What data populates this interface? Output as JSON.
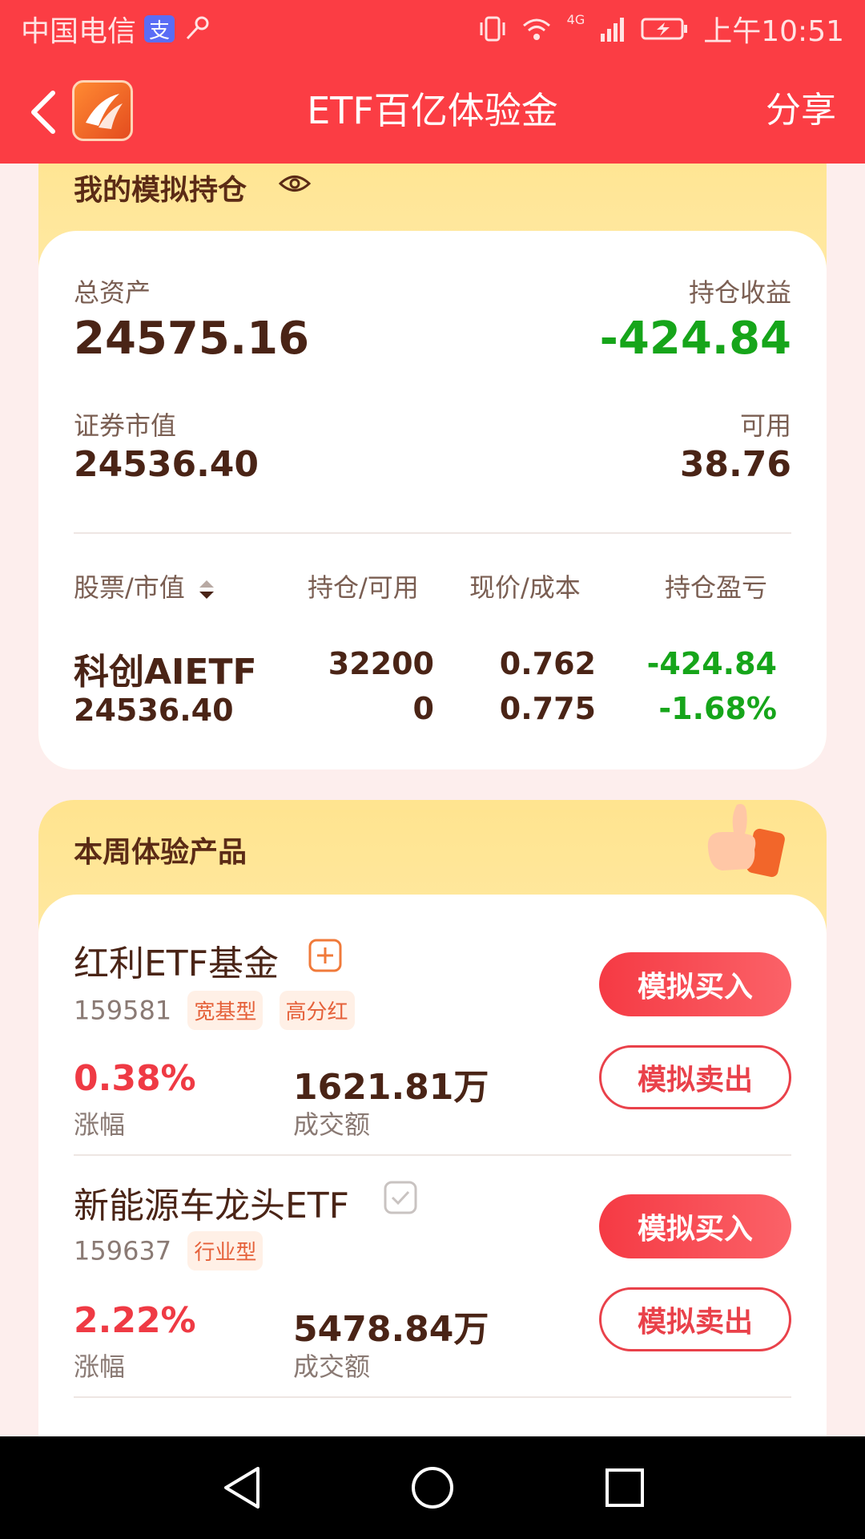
{
  "status_bar": {
    "carrier": "中国电信",
    "alipay_glyph": "支",
    "network": "4G",
    "time": "上午10:51"
  },
  "nav": {
    "title": "ETF百亿体验金",
    "share": "分享"
  },
  "holdings": {
    "title": "我的模拟持仓",
    "total_assets_label": "总资产",
    "total_assets": "24575.16",
    "profit_label": "持仓收益",
    "profit": "-424.84",
    "market_value_label": "证券市值",
    "market_value": "24536.40",
    "available_label": "可用",
    "available": "38.76",
    "columns": [
      "股票/市值",
      "持仓/可用",
      "现价/成本",
      "持仓盈亏"
    ],
    "rows": [
      {
        "name": "科创AIETF",
        "value": "24536.40",
        "position": "32200",
        "available": "0",
        "price": "0.762",
        "cost": "0.775",
        "pnl": "-424.84",
        "pnl_pct": "-1.68%"
      }
    ]
  },
  "products": {
    "title": "本周体验产品",
    "items": [
      {
        "name": "红利ETF基金",
        "code": "159581",
        "tags": [
          "宽基型",
          "高分红"
        ],
        "change": "0.38%",
        "change_label": "涨幅",
        "turnover": "1621.81万",
        "turnover_label": "成交额",
        "buy": "模拟买入",
        "sell": "模拟卖出",
        "icon": "add-icon"
      },
      {
        "name": "新能源车龙头ETF",
        "code": "159637",
        "tags": [
          "行业型"
        ],
        "change": "2.22%",
        "change_label": "涨幅",
        "turnover": "5478.84万",
        "turnover_label": "成交额",
        "buy": "模拟买入",
        "sell": "模拟卖出",
        "icon": "check-icon"
      }
    ]
  },
  "colors": {
    "brand_red": "#fb3d44",
    "loss_green": "#16a51a",
    "gain_red": "#ef3a44",
    "text_brown": "#4a2416"
  }
}
